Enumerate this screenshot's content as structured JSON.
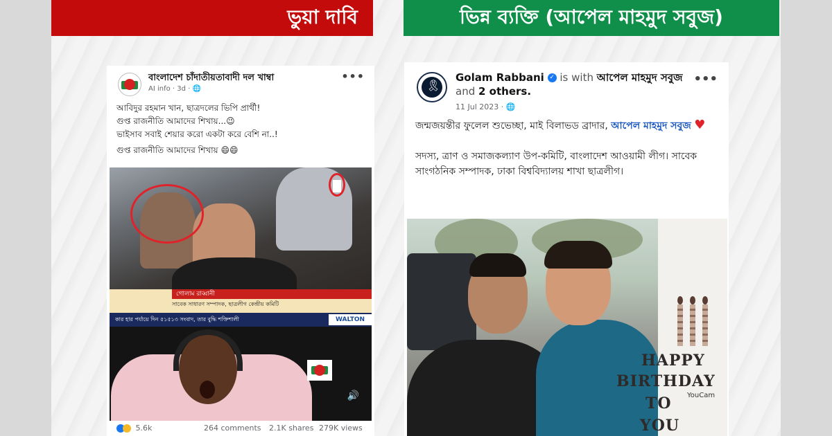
{
  "banners": {
    "left": "ভুয়া দাবি",
    "right": "ভিন্ন ব্যক্তি (আপেল মাহমুদ সবুজ)"
  },
  "left_post": {
    "page_name": "বাংলাদেশ চাঁদাতীয়তাবাদী দল খাম্বা",
    "meta": "AI info · 3d · ",
    "more": "•••",
    "lines": [
      "আবিদুর রহমান খান, ছাত্রদলের ভিপি প্রার্থী!",
      "গুপ্ত রাজনীতি আমাদের শিখায়...😉",
      "ভাইসাব সবাই শেয়ার করো একটা করে বেশি না..!",
      "গুপ্ত রাজনীতি আমাদের শিখায় 😄😄"
    ],
    "video": {
      "lower_third_title": "গোলাম রাব্বানী",
      "lower_third_sub": "সাবেক সাধারণ সম্পাদক, ছাত্রলীগ কেন্দ্রীয় কমিটি",
      "ticker": "কার হার পর্যায়ে দিন ৫১৫১৩ সংবাদ, তার বুদ্ধি শক্তিশালী",
      "brand": "WALTON"
    },
    "reactions": {
      "count": "5.6k",
      "comments": "264 comments",
      "shares": "2.1K shares",
      "views": "279K views"
    }
  },
  "right_post": {
    "author": "Golam Rabbani",
    "is_with": "is with",
    "tagged": "আপেল মাহমুদ সবুজ",
    "and": "and",
    "others": "2 others.",
    "date": "11 Jul 2023 · ",
    "more": "•••",
    "greeting": "জন্মজয়ন্তীর ফুলেল শুভেচ্ছা, মাই বিলাভড ব্রাদার, ",
    "mention": "আপেল মাহমুদ সবুজ",
    "bio": "সদস্য, ত্রাণ ও সমাজকল্যাণ উপ-কমিটি, বাংলাদেশ আওয়ামী লীগ। সাবেক সাংগঠনিক সম্পাদক, ঢাকা বিশ্ববিদ্যালয় শাখা ছাত্রলীগ।",
    "photo_card": {
      "happy": "HAPPY",
      "birthday": "BIRTHDAY",
      "to": "TO",
      "you": "YOU",
      "watermark": "YouCam"
    }
  },
  "colors": {
    "false_claim_banner": "#c30b0b",
    "different_person_banner": "#0f8f4a",
    "facebook_blue": "#1877f2",
    "highlight_circle": "#e0222a"
  }
}
